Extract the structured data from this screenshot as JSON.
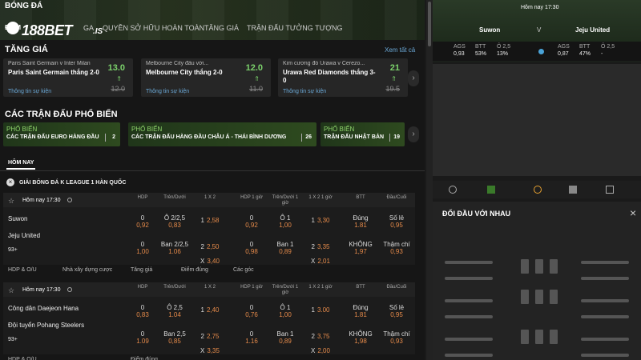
{
  "header": {
    "section": "BÓNG ĐÁ",
    "logo_main": "188BET",
    "logo_suffix": ".IS",
    "nav": [
      "ĐIỂM",
      "GA",
      "QUYỀN SỞ HỮU HOÀN TOÀN",
      "TĂNG GIÁ",
      "TRẬN ĐẤU TƯỞNG TƯỢNG"
    ]
  },
  "boost": {
    "title": "TĂNG GIÁ",
    "see_all": "Xem tất cả",
    "cards": [
      {
        "match": "Paris Saint Germain v Inter Milan",
        "pick": "Paris Saint Germain thắng 2-0",
        "info": "Thông tin sự kiện",
        "odd": "13.0",
        "old": "12.0"
      },
      {
        "match": "Melbourne City đấu với...",
        "pick": "Melbourne City thắng 2-0",
        "info": "Thông tin sự kiện",
        "odd": "12.0",
        "old": "11.0"
      },
      {
        "match": "Kim cương đỏ Urawa v Cerezo...",
        "pick": "Urawa Red Diamonds thắng 3-0",
        "info": "Thông tin sự kiện",
        "odd": "21",
        "old": "19.5"
      }
    ]
  },
  "popular": {
    "title": "CÁC TRẬN ĐẤU PHỔ BIẾN",
    "items": [
      {
        "tag": "PHỔ BIẾN",
        "name": "CÁC TRẬN ĐẤU EURO HÀNG ĐẦU",
        "count": "2"
      },
      {
        "tag": "PHỔ BIẾN",
        "name": "CÁC TRẬN ĐẤU HÀNG ĐẦU CHÂU Á - THÁI BÌNH DƯƠNG",
        "count": "26"
      },
      {
        "tag": "PHỔ BIẾN",
        "name": "TRẬN ĐẤU NHẬT BẢN",
        "count": "19"
      }
    ]
  },
  "today_tab": "HÔM NAY",
  "league": "GIẢI BÓNG ĐÁ K LEAGUE 1 HÀN QUỐC",
  "columns": [
    "HDP",
    "Trên/Dưới",
    "1 X 2",
    "HDP\n1 giờ",
    "Trên/Dưới\n1 giờ",
    "1 X 2\n1 giờ",
    "BTT",
    "Đầu/Cuối"
  ],
  "matches": [
    {
      "time": "Hôm nay 17:30",
      "home": "Suwon",
      "away": "Jeju United",
      "more": "93+",
      "r1": [
        [
          "0",
          "0,92"
        ],
        [
          "Ô 2/2,5",
          "0,83"
        ],
        [
          "1",
          "2,58"
        ],
        [
          "0",
          "0,92"
        ],
        [
          "Ô 1",
          "1,00"
        ],
        [
          "1",
          "3,30"
        ],
        [
          "Đúng",
          "1.81"
        ],
        [
          "Số lẻ",
          "0,95"
        ]
      ],
      "r2": [
        [
          "0",
          "1,00"
        ],
        [
          "Ban 2/2,5",
          "1.06"
        ],
        [
          "2",
          "2,50"
        ],
        [
          "0",
          "0,98"
        ],
        [
          "Ban 1",
          "0,89"
        ],
        [
          "2",
          "3,35"
        ],
        [
          "KHÔNG",
          "1,97"
        ],
        [
          "Thậm chí",
          "0,93"
        ]
      ],
      "r3": [
        "",
        "",
        "X",
        "3,40",
        "",
        "",
        "X",
        "2,01"
      ],
      "chips": [
        "HDP & O/U",
        "Nhà xây dựng cược",
        "Tăng giá",
        "Điểm đúng",
        "Các góc"
      ]
    },
    {
      "time": "Hôm nay 17:30",
      "home": "Công dân Daejeon Hana",
      "away": "Đội tuyển Pohang Steelers",
      "more": "93+",
      "r1": [
        [
          "0",
          "0,83"
        ],
        [
          "Ô 2,5",
          "1.04"
        ],
        [
          "1",
          "2,40"
        ],
        [
          "0",
          "0,76"
        ],
        [
          "Ô 1",
          "1,00"
        ],
        [
          "1",
          "3.00"
        ],
        [
          "Đúng",
          "1.81"
        ],
        [
          "Số lẻ",
          "0,95"
        ]
      ],
      "r2": [
        [
          "0",
          "1.09"
        ],
        [
          "Ban 2,5",
          "0,85"
        ],
        [
          "2",
          "2,75"
        ],
        [
          "0",
          "1.16"
        ],
        [
          "Ban 1",
          "0,89"
        ],
        [
          "2",
          "3,75"
        ],
        [
          "KHÔNG",
          "1,98"
        ],
        [
          "Thậm chí",
          "0,93"
        ]
      ],
      "r3": [
        "",
        "",
        "X",
        "3,35",
        "",
        "",
        "X",
        "2,00"
      ],
      "chips": [
        "HDP & O/U",
        "",
        "Điểm đúng",
        ""
      ]
    }
  ],
  "scoreboard": {
    "time": "Hôm nay 17:30",
    "home": "Suwon",
    "vs": "V",
    "away": "Jeju United",
    "left": {
      "h": [
        "AGS",
        "BTT",
        "Ô 2,5"
      ],
      "v": [
        "0,93",
        "53%",
        "13%"
      ]
    },
    "right": {
      "h": [
        "AGS",
        "BTT",
        "Ô 2,5"
      ],
      "v": [
        "0,87",
        "47%",
        "-"
      ]
    }
  },
  "h2h": {
    "title": "ĐỐI ĐẦU VỚI NHAU"
  },
  "colors": {
    "accent": "#7bd16b",
    "odd": "#e58a4a",
    "link": "#6aa8d6"
  }
}
